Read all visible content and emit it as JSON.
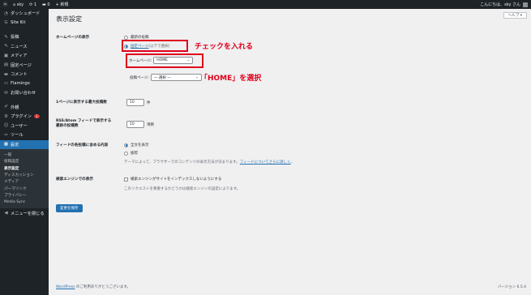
{
  "adminbar": {
    "site_name": "sky",
    "updates_count": "1",
    "comments_count": "0",
    "new_label": "+ 新規",
    "greeting": "こんにちは、sky さん"
  },
  "sidebar": {
    "items": [
      {
        "label": "ダッシュボード",
        "icon": "dashboard-icon",
        "glyph": "◔"
      },
      {
        "label": "Site Kit",
        "icon": "sitekit-icon",
        "glyph": "G"
      },
      {
        "label": "投稿",
        "icon": "pin-icon",
        "glyph": "✎"
      },
      {
        "label": "ニュース",
        "icon": "pin-icon",
        "glyph": "✎"
      },
      {
        "label": "メディア",
        "icon": "media-icon",
        "glyph": "▣"
      },
      {
        "label": "固定ページ",
        "icon": "page-icon",
        "glyph": "▤"
      },
      {
        "label": "コメント",
        "icon": "comment-icon",
        "glyph": "▬"
      },
      {
        "label": "Flamingo",
        "icon": "flamingo-icon",
        "glyph": "▭"
      },
      {
        "label": "お問い合わせ",
        "icon": "mail-icon",
        "glyph": "✉"
      },
      {
        "label": "外観",
        "icon": "appearance-icon",
        "glyph": "✐"
      },
      {
        "label": "プラグイン",
        "icon": "plugin-icon",
        "glyph": "⚙",
        "badge": "1"
      },
      {
        "label": "ユーザー",
        "icon": "user-icon",
        "glyph": "☺"
      },
      {
        "label": "ツール",
        "icon": "tool-icon",
        "glyph": "✂"
      },
      {
        "label": "設定",
        "icon": "settings-icon",
        "glyph": "▦"
      }
    ],
    "submenu": [
      "一般",
      "投稿設定",
      "表示設定",
      "ディスカッション",
      "メディア",
      "パーマリンク",
      "プライバシー",
      "Media Sync"
    ],
    "collapse_label": "メニューを閉じる"
  },
  "page": {
    "title": "表示設定",
    "help_label": "ヘルプ ▾"
  },
  "homepage": {
    "label": "ホームページの表示",
    "option_latest": "最新の投稿",
    "option_static_link": "固定ページ",
    "option_static_suffix": " (以下で選択)",
    "homepage_label": "ホームページ:",
    "homepage_value": "HOME",
    "postspage_label": "投稿ページ:",
    "postspage_value": "— 選択 —"
  },
  "annotations": {
    "check": "チェックを入れる",
    "select_home": "「HOME」を選択"
  },
  "posts_per_page": {
    "label": "1ページに表示する最大投稿数",
    "value": "10",
    "unit": "件"
  },
  "feed_items": {
    "label_line1": "RSS/Atom フィードで表示する",
    "label_line2": "最新の投稿数",
    "value": "10",
    "unit": "項目"
  },
  "feed_content": {
    "label": "フィードの各投稿に含める内容",
    "option_full": "全文を表示",
    "option_excerpt": "抜粋",
    "note_text": "テーマによって、ブラウザーでのコンテンツの表示方法が決まります。",
    "note_link": "フィードについてさらに詳しく",
    "note_end": "。"
  },
  "search_engine": {
    "label": "検索エンジンでの表示",
    "checkbox_label": "検索エンジンがサイトをインデックスしないようにする",
    "note": "このリクエストを尊重するかどうかは検索エンジンの設定によります。"
  },
  "save_label": "変更を保存",
  "footer": {
    "link": "WordPress",
    "text": " のご利用ありがとうございます。",
    "version": "バージョン 6.5.4"
  },
  "colors": {
    "accent": "#2271b1",
    "annotation_red": "#e0001b",
    "sidebar_bg": "#1d2327"
  }
}
